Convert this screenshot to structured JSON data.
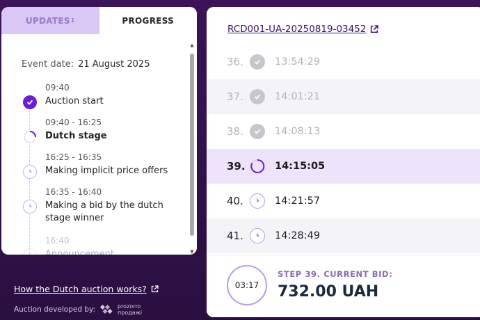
{
  "tabs": [
    {
      "label": "UPDATES",
      "badge": "1",
      "active": false
    },
    {
      "label": "PROGRESS",
      "active": true
    }
  ],
  "event": {
    "label": "Event date:",
    "value": "21 August 2025"
  },
  "timeline": [
    {
      "time": "09:40",
      "title": "Auction start",
      "status": "done",
      "icon": "check-icon"
    },
    {
      "time": "09:40 - 16:25",
      "title": "Dutch stage",
      "status": "current",
      "icon": "progress-ring-icon"
    },
    {
      "time": "16:25 - 16:35",
      "title": "Making implicit price offers",
      "status": "upcoming",
      "icon": "clock-icon"
    },
    {
      "time": "16:35 - 16:40",
      "title": "Making a bid by the dutch stage winner",
      "status": "upcoming",
      "icon": "clock-icon"
    },
    {
      "time": "16:40",
      "title": "Announcement",
      "status": "upcoming",
      "icon": "clock-icon"
    }
  ],
  "links": {
    "how_it_works": "How the Dutch auction works?",
    "developed_by": "Auction developed by:",
    "logo_line1": "prozorro",
    "logo_line2": "продажі"
  },
  "auction": {
    "id": "RCD001-UA-20250819-03452"
  },
  "steps": [
    {
      "num": "36.",
      "time": "13:54:29",
      "status": "past"
    },
    {
      "num": "37.",
      "time": "14:01:21",
      "status": "past"
    },
    {
      "num": "38.",
      "time": "14:08:13",
      "status": "past"
    },
    {
      "num": "39.",
      "time": "14:15:05",
      "status": "current"
    },
    {
      "num": "40.",
      "time": "14:21:57",
      "status": "future"
    },
    {
      "num": "41.",
      "time": "14:28:49",
      "status": "future"
    }
  ],
  "bid": {
    "timer": "03:17",
    "label": "STEP 39. CURRENT BID:",
    "value": "732.00 UAH"
  },
  "colors": {
    "accent": "#6a1ed0",
    "background": "#2a0f40",
    "current_row": "#ede3fb"
  }
}
